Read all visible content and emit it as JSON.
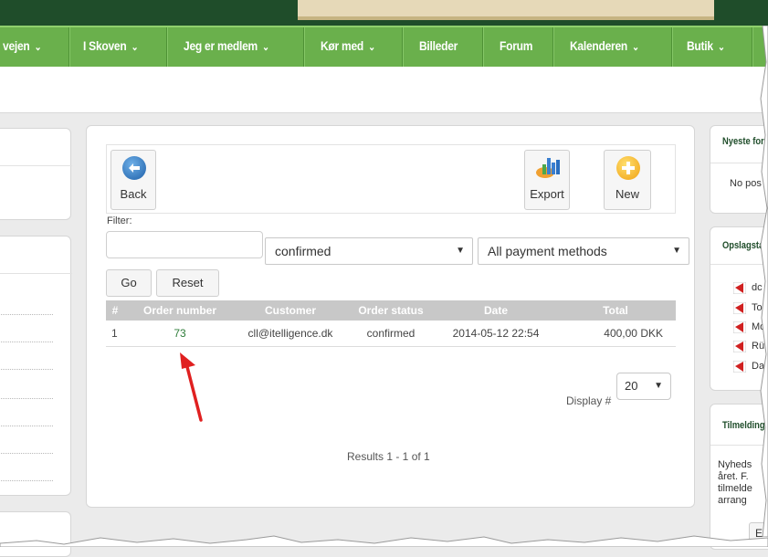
{
  "nav": {
    "items": [
      {
        "label": "vejen",
        "left": 0
      },
      {
        "label": "I Skoven"
      },
      {
        "label": "Jeg er medlem"
      },
      {
        "label": "Kør med"
      },
      {
        "label": "Billeder"
      },
      {
        "label": "Forum"
      },
      {
        "label": "Kalenderen"
      },
      {
        "label": "Butik"
      }
    ]
  },
  "toolbar": {
    "back_label": "Back",
    "export_label": "Export",
    "new_label": "New"
  },
  "filter": {
    "label": "Filter:",
    "input_value": "",
    "status_selected": "confirmed",
    "payment_selected": "All payment methods",
    "go_label": "Go",
    "reset_label": "Reset"
  },
  "table": {
    "headers": [
      "#",
      "Order number",
      "Customer",
      "Order status",
      "Date",
      "Total"
    ],
    "rows": [
      {
        "index": "1",
        "order_number": "73",
        "customer": "cll@itelligence.dk",
        "status": "confirmed",
        "date": "2014-05-12 22:54",
        "total": "400,00 DKK"
      }
    ]
  },
  "pagination": {
    "display_label": "Display #",
    "display_value": "20",
    "results_text": "Results 1 - 1 of 1"
  },
  "sidebar": {
    "newest_title": "Nyeste for",
    "newest_text": "No pos",
    "notice_title": "Opslagsta",
    "files": [
      "dc",
      "To",
      "Mo",
      "Rü",
      "Da"
    ],
    "signup_title": "Tilmelding",
    "signup_lines": [
      "Nyheds",
      "året. F.",
      "tilmelde",
      "arrang"
    ],
    "signup_button": "E"
  },
  "colors": {
    "nav_green": "#6ab04c",
    "dark_green": "#1f4d2a",
    "link_green": "#2f7d3a",
    "annotation_red": "#e02020",
    "header_gray": "#c8c8c8"
  }
}
